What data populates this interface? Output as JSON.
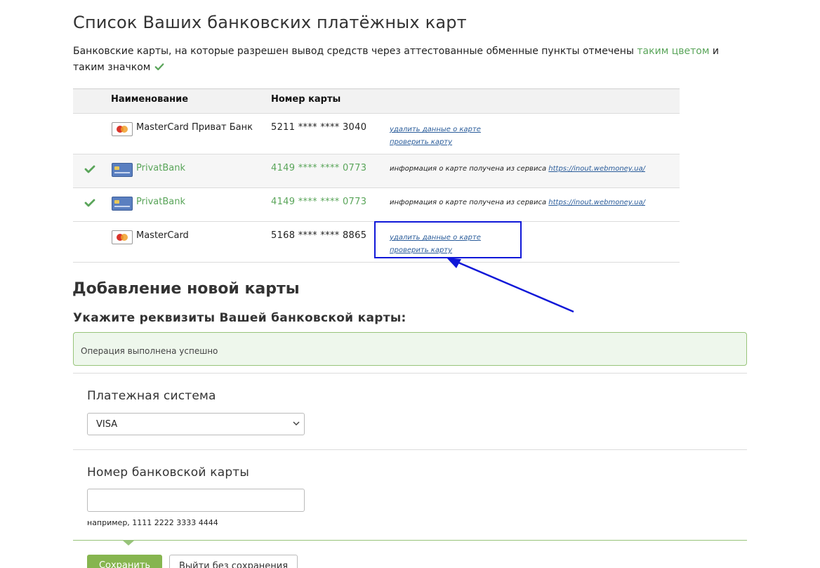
{
  "page": {
    "title": "Список Ваших банковских платёжных карт",
    "intro_before": "Банковские карты, на которые разрешен вывод средств через аттестованные обменные пункты отмечены ",
    "intro_highlight": "таким цветом",
    "intro_after": " и таким значком",
    "highlight_color": "#5aa55a"
  },
  "table": {
    "headers": {
      "name": "Наименование",
      "number": "Номер карты"
    },
    "rows": [
      {
        "verified": false,
        "icon": "mastercard-icon",
        "name": "MasterCard Приват Банк",
        "number": "5211 **** **** 3040",
        "delete_label": "удалить данные о карте",
        "check_label": "проверить карту"
      },
      {
        "verified": true,
        "icon": "bank-card-icon",
        "name": "PrivatBank",
        "number": "4149 **** **** 0773",
        "info_text": "информация о карте получена из сервиса ",
        "info_link": "https://inout.webmoney.ua/"
      },
      {
        "verified": true,
        "icon": "bank-card-icon",
        "name": "PrivatBank",
        "number": "4149 **** **** 0773",
        "info_text": "информация о карте получена из сервиса ",
        "info_link": "https://inout.webmoney.ua/"
      },
      {
        "verified": false,
        "icon": "mastercard-icon",
        "name": "MasterCard",
        "number": "5168 **** **** 8865",
        "delete_label": "удалить данные о карте",
        "check_label": "проверить карту"
      }
    ]
  },
  "add_card": {
    "heading": "Добавление новой карты",
    "subheading": "Укажите реквизиты Вашей банковской карты:",
    "success_message": "Операция выполнена успешно",
    "payment_system_label": "Платежная система",
    "payment_system_value": "VISA",
    "card_number_label": "Номер банковской карты",
    "card_number_value": "",
    "card_number_hint": "например, 1111 2222 3333 4444",
    "save_label": "Сохранить",
    "exit_label": "Выйти без сохранения"
  },
  "annotation": {
    "color": "#1018d8"
  }
}
